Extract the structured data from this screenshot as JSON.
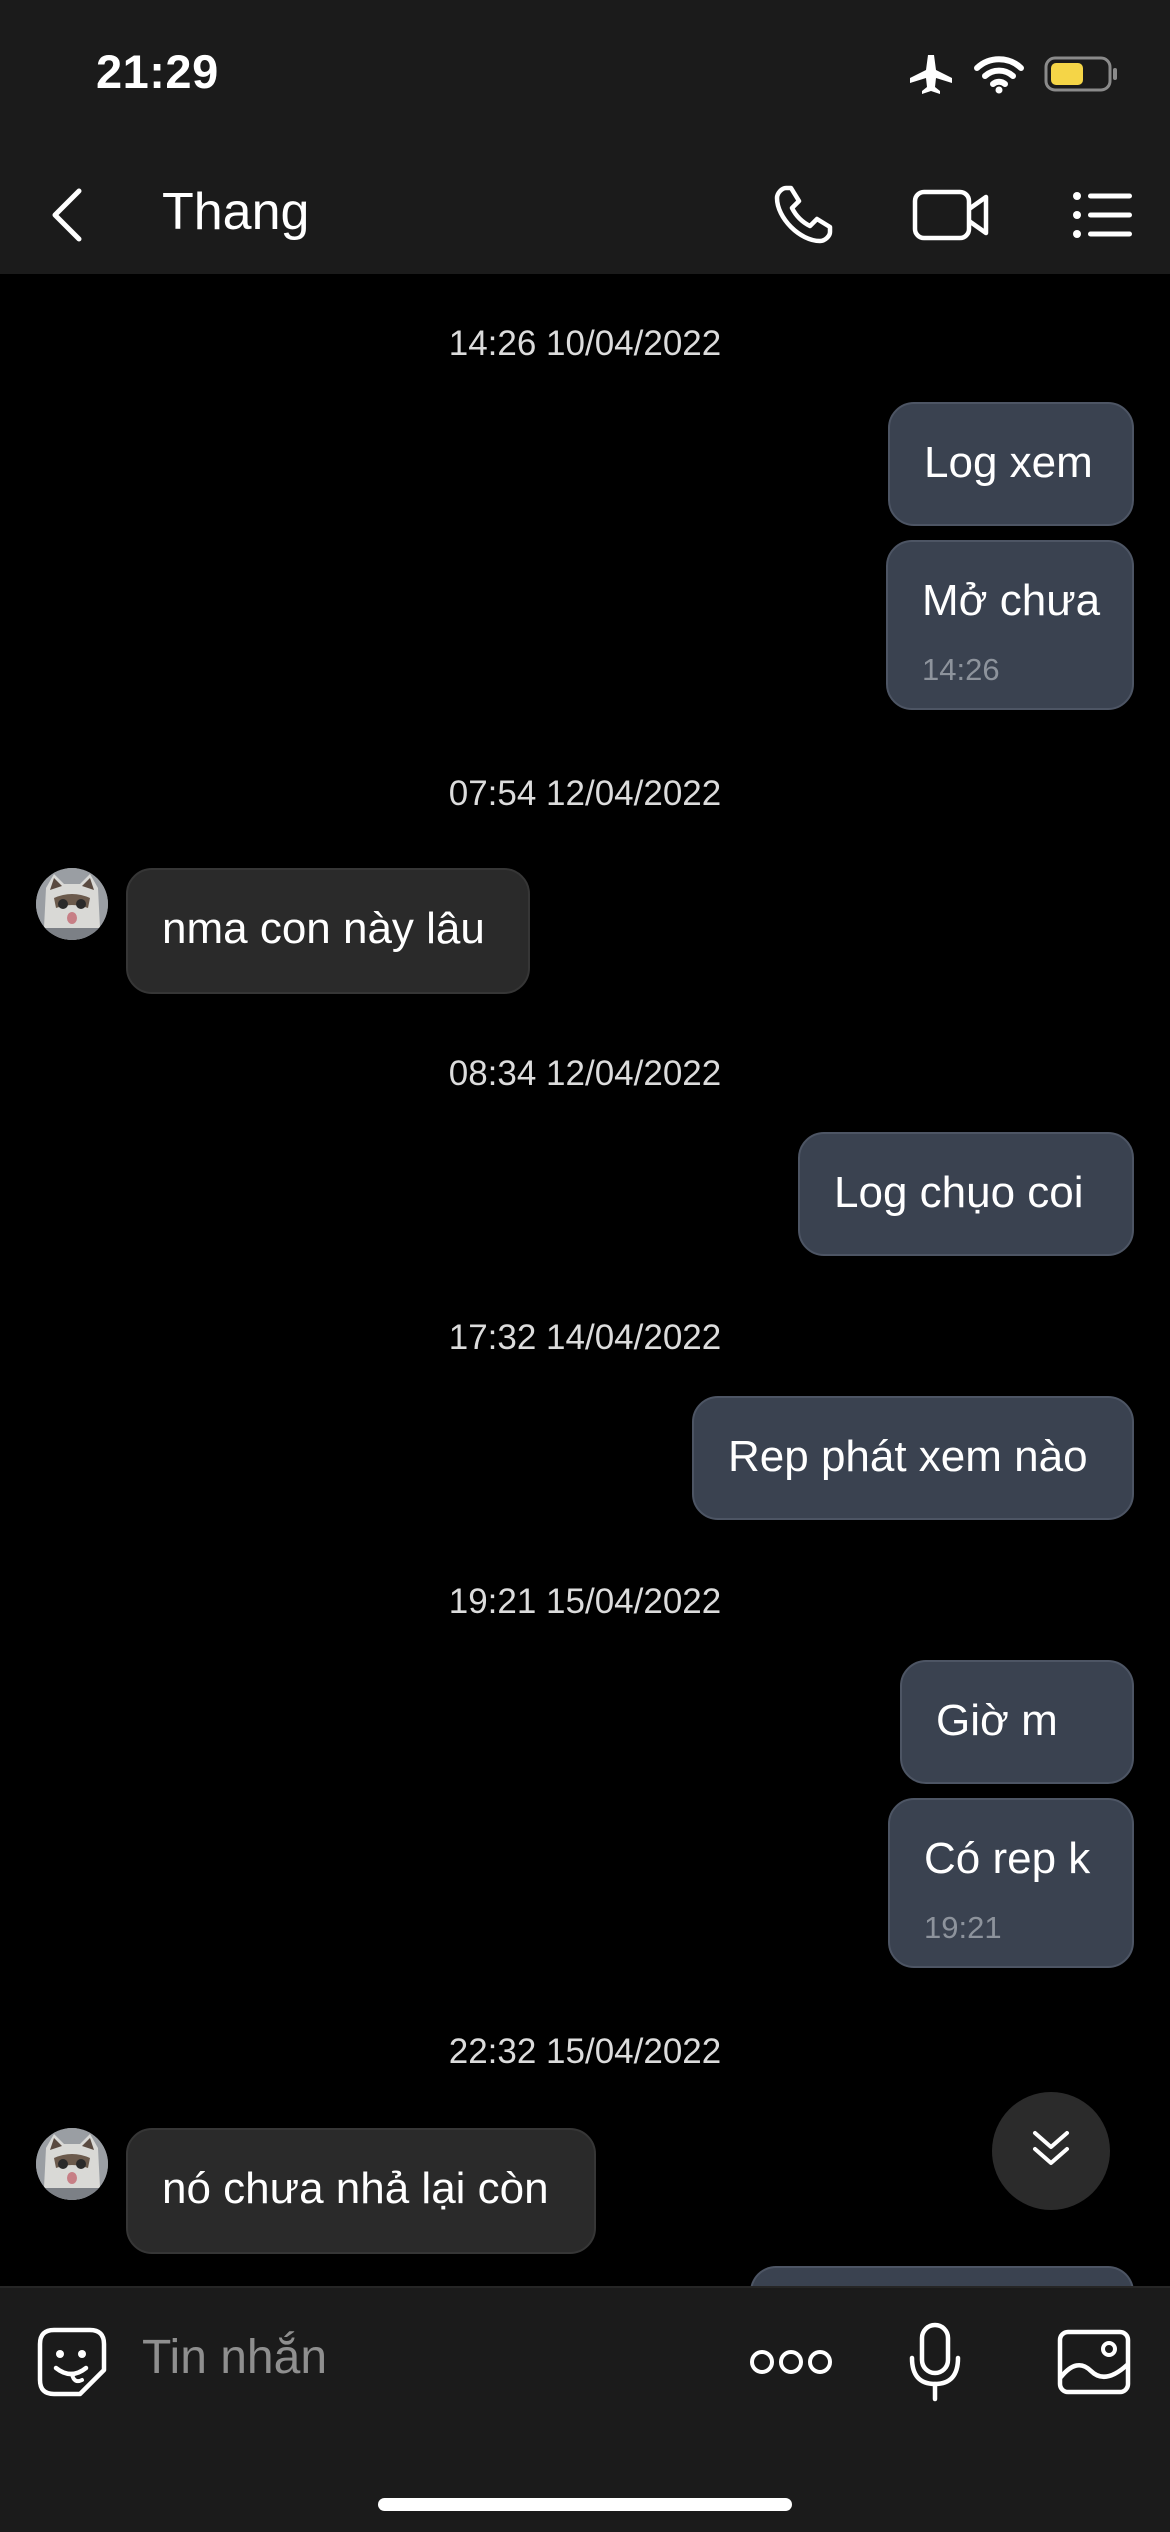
{
  "status_bar": {
    "time": "21:29"
  },
  "header": {
    "title": "Thang"
  },
  "messages": [
    {
      "kind": "timestamp",
      "text": "14:26 10/04/2022"
    },
    {
      "kind": "outgoing",
      "text": "Log xem"
    },
    {
      "kind": "outgoing",
      "text": "Mở chưa",
      "time": "14:26"
    },
    {
      "kind": "timestamp",
      "text": "07:54 12/04/2022"
    },
    {
      "kind": "incoming",
      "text": "nma con này lâu"
    },
    {
      "kind": "timestamp",
      "text": "08:34 12/04/2022"
    },
    {
      "kind": "outgoing",
      "text": "Log chụo coi"
    },
    {
      "kind": "timestamp",
      "text": "17:32 14/04/2022"
    },
    {
      "kind": "outgoing",
      "text": "Rep phát xem nào"
    },
    {
      "kind": "timestamp",
      "text": "19:21 15/04/2022"
    },
    {
      "kind": "outgoing",
      "text": "Giờ m"
    },
    {
      "kind": "outgoing",
      "text": "Có rep k",
      "time": "19:21"
    },
    {
      "kind": "timestamp",
      "text": "22:32 15/04/2022"
    },
    {
      "kind": "incoming",
      "text": "nó chưa nhả lại còn"
    }
  ],
  "composer": {
    "placeholder": "Tin nhắn"
  },
  "icons": {
    "status": [
      "airplane-icon",
      "wifi-icon",
      "battery-icon"
    ],
    "header": [
      "back-chevron-icon",
      "phone-icon",
      "video-camera-icon",
      "list-menu-icon"
    ],
    "composer": [
      "sticker-emoji-icon",
      "more-dots-icon",
      "microphone-icon",
      "image-icon"
    ],
    "scroll": "double-chevron-down-icon"
  },
  "colors": {
    "outgoing_bubble": "#3a4250",
    "incoming_bubble": "#2a2a2a",
    "battery": "#f5d547"
  }
}
